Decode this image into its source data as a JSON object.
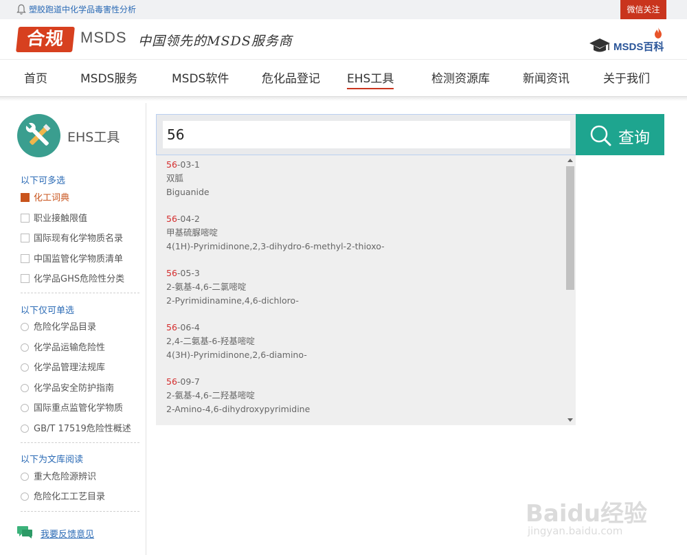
{
  "topbar": {
    "notice": "塑胶跑道中化学品毒害性分析",
    "wechat_label": "微信关注"
  },
  "header": {
    "logo_text": "合规",
    "logo_msds": "MSDS",
    "slogan": "中国领先的MSDS服务商",
    "baike_label": "MSDS百科"
  },
  "nav": {
    "items": [
      {
        "label": "首页"
      },
      {
        "label": "MSDS服务"
      },
      {
        "label": "MSDS软件"
      },
      {
        "label": "危化品登记"
      },
      {
        "label": "EHS工具"
      },
      {
        "label": "检测资源库"
      },
      {
        "label": "新闻资讯"
      },
      {
        "label": "关于我们"
      }
    ],
    "active_index": 4
  },
  "sidebar": {
    "title": "EHS工具",
    "multi_title": "以下可多选",
    "multi_options": [
      {
        "label": "化工词典",
        "checked": true
      },
      {
        "label": "职业接触限值",
        "checked": false
      },
      {
        "label": "国际现有化学物质名录",
        "checked": false
      },
      {
        "label": "中国监管化学物质清单",
        "checked": false
      },
      {
        "label": "化学品GHS危险性分类",
        "checked": false
      }
    ],
    "single_title": "以下仅可单选",
    "single_options": [
      {
        "label": "危险化学品目录"
      },
      {
        "label": "化学品运输危险性"
      },
      {
        "label": "化学品管理法规库"
      },
      {
        "label": "化学品安全防护指南"
      },
      {
        "label": "国际重点监管化学物质"
      },
      {
        "label": "GB/T 17519危险性概述"
      }
    ],
    "library_title": "以下为文库阅读",
    "library_options": [
      {
        "label": "重大危险源辨识"
      },
      {
        "label": "危险化工工艺目录"
      }
    ],
    "feedback_label": "我要反馈意见"
  },
  "search": {
    "value": "56",
    "button_label": "查询"
  },
  "suggestions": [
    {
      "cas_prefix": "56",
      "cas_rest": "-03-1",
      "cn": "双胍",
      "en": "Biguanide"
    },
    {
      "cas_prefix": "56",
      "cas_rest": "-04-2",
      "cn": "甲基硫脲嘧啶",
      "en": "4(1H)-Pyrimidinone,2,3-dihydro-6-methyl-2-thioxo-"
    },
    {
      "cas_prefix": "56",
      "cas_rest": "-05-3",
      "cn": "2-氨基-4,6-二氯嘧啶",
      "en": "2-Pyrimidinamine,4,6-dichloro-"
    },
    {
      "cas_prefix": "56",
      "cas_rest": "-06-4",
      "cn": "2,4-二氨基-6-羟基嘧啶",
      "en": "4(3H)-Pyrimidinone,2,6-diamino-"
    },
    {
      "cas_prefix": "56",
      "cas_rest": "-09-7",
      "cn": "2-氨基-4,6-二羟基嘧啶",
      "en": "2-Amino-4,6-dihydroxypyrimidine"
    }
  ],
  "watermark": {
    "main": "Baidu经验",
    "sub": "jingyan.baidu.com"
  },
  "colors": {
    "accent_red": "#c9341d",
    "teal": "#1ea58f",
    "link_blue": "#2a6ab5",
    "highlight_red": "#d42b2b"
  },
  "icons": [
    "bell-icon",
    "graduation-cap-icon",
    "flame-icon",
    "wrench-screwdriver-icon",
    "search-icon",
    "chat-bubble-icon",
    "scroll-up-icon",
    "scroll-down-icon"
  ]
}
